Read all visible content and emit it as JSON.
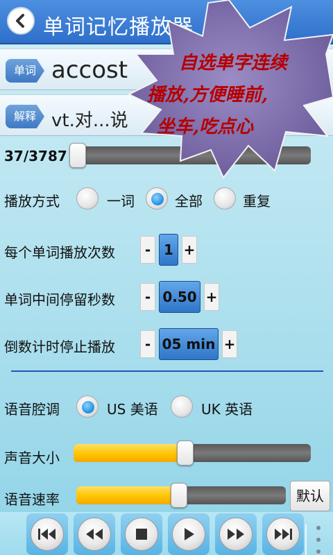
{
  "header": {
    "title": "单词记忆播放器"
  },
  "word_row": {
    "tag": "单词",
    "value": "accost"
  },
  "explain_row": {
    "tag": "解释",
    "value": "vt.对...说"
  },
  "progress": {
    "label": "37/3787",
    "fraction": 0.0098
  },
  "play_mode": {
    "label": "播放方式",
    "options": [
      "一词",
      "全部",
      "重复"
    ],
    "selected": "全部"
  },
  "repeat_count": {
    "label": "每个单词播放次数",
    "minus": "-",
    "value": "1",
    "plus": "+"
  },
  "pause_seconds": {
    "label": "单词中间停留秒数",
    "minus": "-",
    "value": "0.50",
    "plus": "+"
  },
  "countdown": {
    "label": "倒数计时停止播放",
    "minus": "-",
    "value": "05 min",
    "plus": "+"
  },
  "accent": {
    "label": "语音腔调",
    "options": [
      "US 美语",
      "UK 英语"
    ],
    "selected": "US 美语"
  },
  "volume": {
    "label": "声音大小",
    "level": 0.47
  },
  "speed": {
    "label": "语音速率",
    "level": 0.49,
    "default_label": "默认"
  },
  "playback_controls": [
    "skip-to-start-icon",
    "rewind-icon",
    "stop-icon",
    "play-icon",
    "fast-forward-icon",
    "skip-to-end-icon"
  ],
  "promo": {
    "line1": "自选单字连续",
    "line2": "播放,方便睡前,",
    "line3": "坐车,吃点心"
  },
  "colors": {
    "accent_blue": "#2f6fcb",
    "slider_fill": "#ffc400",
    "promo_burst": "#7b6aa4",
    "promo_text": "#b50000"
  }
}
